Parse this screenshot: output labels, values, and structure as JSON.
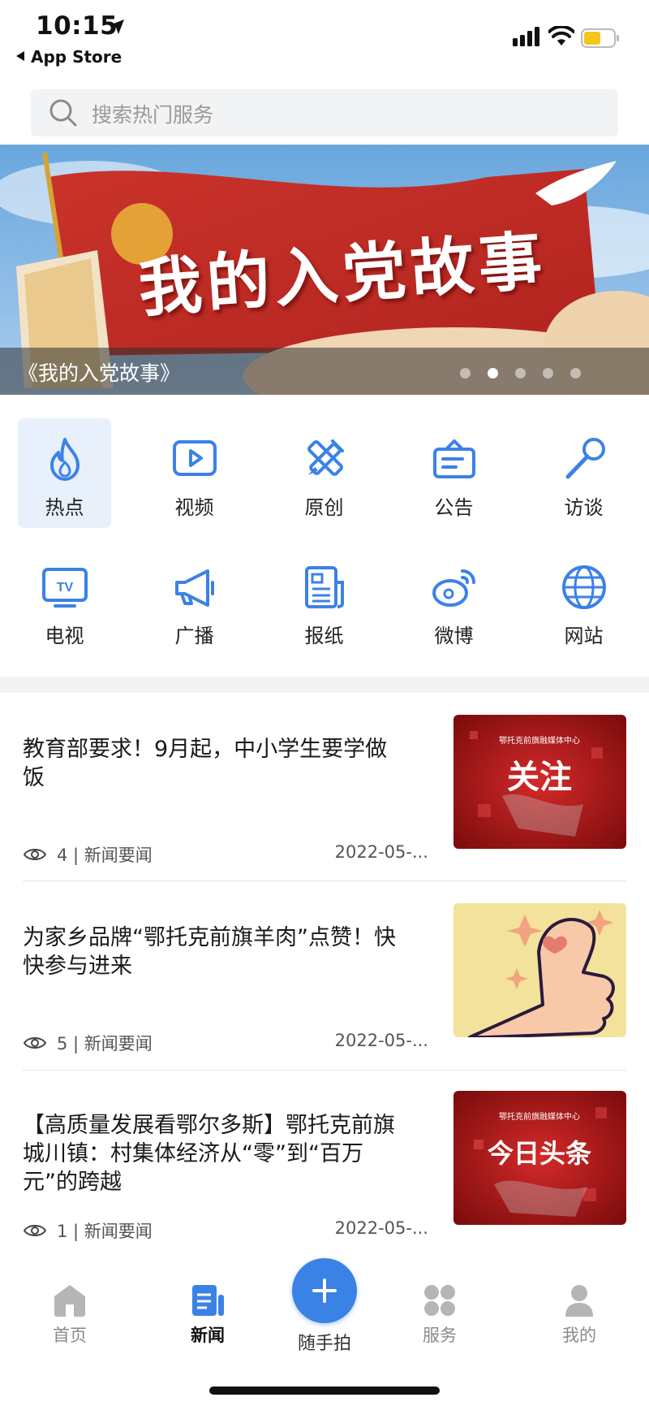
{
  "status_bar": {
    "time": "10:15",
    "back_label": "App Store"
  },
  "search": {
    "placeholder": "搜索热门服务"
  },
  "banner": {
    "title": "我的入党故事",
    "caption": "《我的入党故事》",
    "dots": 5,
    "active_dot": 1
  },
  "categories": [
    {
      "label": "热点",
      "icon": "flame-icon",
      "active": true
    },
    {
      "label": "视频",
      "icon": "video-play-icon",
      "active": false
    },
    {
      "label": "原创",
      "icon": "pencil-ruler-icon",
      "active": false
    },
    {
      "label": "公告",
      "icon": "notice-board-icon",
      "active": false
    },
    {
      "label": "访谈",
      "icon": "microphone-icon",
      "active": false
    },
    {
      "label": "电视",
      "icon": "tv-icon",
      "active": false
    },
    {
      "label": "广播",
      "icon": "megaphone-icon",
      "active": false
    },
    {
      "label": "报纸",
      "icon": "newspaper-icon",
      "active": false
    },
    {
      "label": "微博",
      "icon": "weibo-icon",
      "active": false
    },
    {
      "label": "网站",
      "icon": "globe-icon",
      "active": false
    }
  ],
  "news": [
    {
      "title": "教育部要求！9月起，中小学生要学做饭",
      "views": "4 | 新闻要闻",
      "date": "2022-05-...",
      "thumb_org": "鄂托克前旗融媒体中心",
      "thumb_text": "关注"
    },
    {
      "title": "为家乡品牌“鄂托克前旗羊肉”点赞！快快参与进来",
      "views": "5 | 新闻要闻",
      "date": "2022-05-...",
      "thumb_org": "",
      "thumb_text": ""
    },
    {
      "title": "【高质量发展看鄂尔多斯】鄂托克前旗城川镇：村集体经济从“零”到“百万元”的跨越",
      "views": "1 | 新闻要闻",
      "date": "2022-05-...",
      "thumb_org": "鄂托克前旗融媒体中心",
      "thumb_text": "今日头条"
    }
  ],
  "tabbar": {
    "home": "首页",
    "news": "新闻",
    "snap": "随手拍",
    "services": "服务",
    "mine": "我的"
  },
  "colors": {
    "accent": "#3b82e6",
    "icon_blue": "#3b82e6",
    "active_tab_bg": "#e8f0fb"
  }
}
